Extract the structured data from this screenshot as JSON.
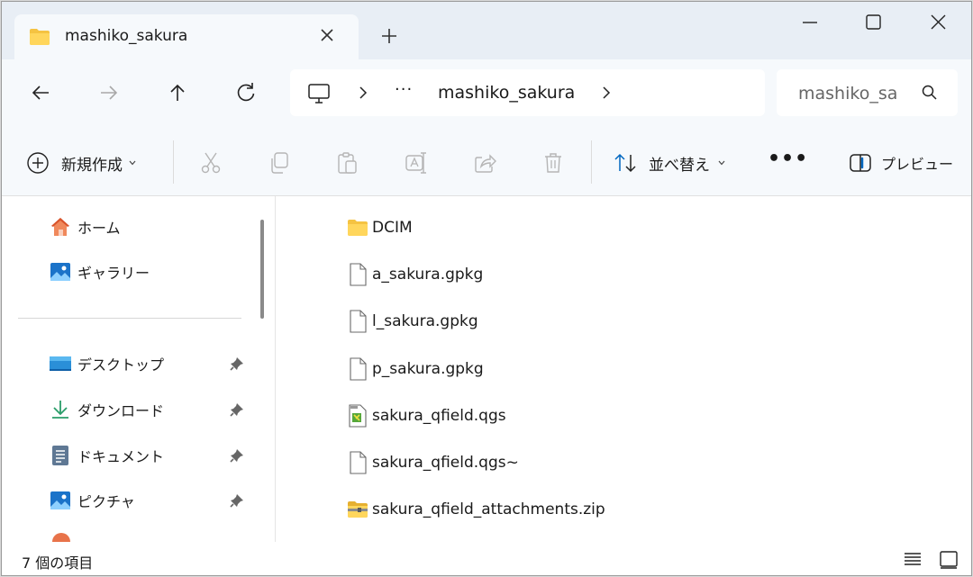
{
  "window": {
    "tab_title": "mashiko_sakura"
  },
  "address": {
    "overflow": "···",
    "crumb": "mashiko_sakura"
  },
  "search": {
    "placeholder": "mashiko_sa"
  },
  "toolbar": {
    "new_label": "新規作成",
    "sort_label": "並べ替え",
    "more_label": "•••",
    "preview_label": "プレビュー"
  },
  "sidebar": {
    "items": [
      {
        "label": "ホーム",
        "icon": "home-icon"
      },
      {
        "label": "ギャラリー",
        "icon": "gallery-icon"
      },
      {
        "label": "デスクトップ",
        "icon": "desktop-icon",
        "pinned": true
      },
      {
        "label": "ダウンロード",
        "icon": "download-icon",
        "pinned": true
      },
      {
        "label": "ドキュメント",
        "icon": "document-icon",
        "pinned": true
      },
      {
        "label": "ピクチャ",
        "icon": "pictures-icon",
        "pinned": true
      }
    ]
  },
  "files": [
    {
      "name": "DCIM",
      "icon": "folder-icon"
    },
    {
      "name": "a_sakura.gpkg",
      "icon": "file-icon"
    },
    {
      "name": "l_sakura.gpkg",
      "icon": "file-icon"
    },
    {
      "name": "p_sakura.gpkg",
      "icon": "file-icon"
    },
    {
      "name": "sakura_qfield.qgs",
      "icon": "qgis-project-icon"
    },
    {
      "name": "sakura_qfield.qgs~",
      "icon": "file-icon"
    },
    {
      "name": "sakura_qfield_attachments.zip",
      "icon": "zip-folder-icon"
    }
  ],
  "status": {
    "item_count": "7 個の項目"
  },
  "colors": {
    "accent": "#0067c0",
    "folder": "#f5c342",
    "titlebar": "#e8eef5",
    "toolbar": "#f6f9fc"
  }
}
